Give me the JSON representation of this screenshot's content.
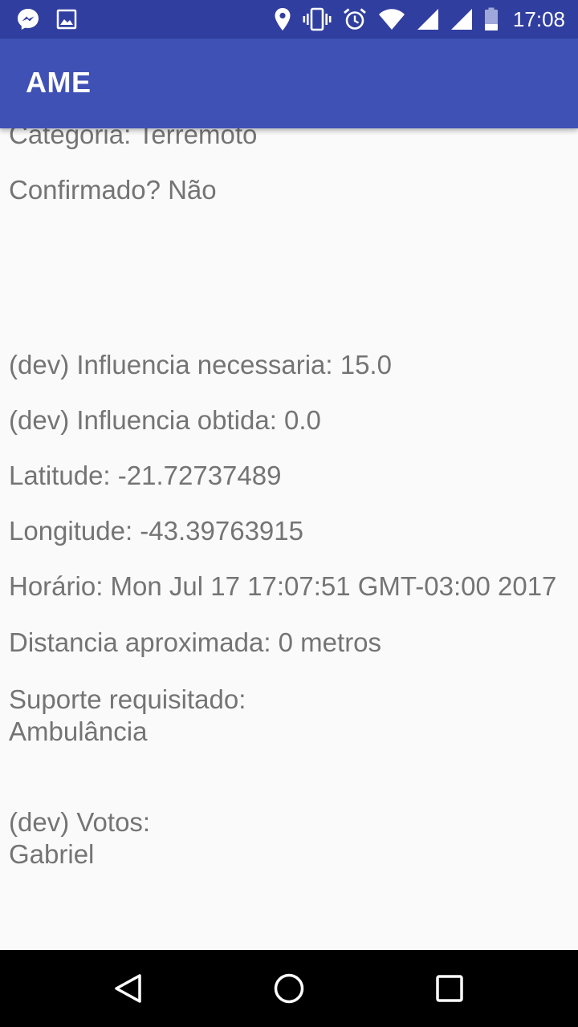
{
  "status_bar": {
    "time": "17:08",
    "icons_left": [
      "messenger-icon",
      "image-icon"
    ],
    "icons_right": [
      "location-icon",
      "vibrate-icon",
      "alarm-icon",
      "wifi-icon",
      "signal-icon",
      "signal-icon",
      "battery-icon"
    ],
    "color": "#303f9f"
  },
  "app_bar": {
    "title": "AME",
    "color": "#3f51b5"
  },
  "details": {
    "categoria": "Categoria: Terremoto",
    "confirmado": "Confirmado? Não",
    "influencia_necessaria": "(dev) Influencia necessaria: 15.0",
    "influencia_obtida": "(dev) Influencia obtida: 0.0",
    "latitude": "Latitude: -21.72737489",
    "longitude": "Longitude: -43.39763915",
    "horario": "Horário: Mon Jul 17 17:07:51 GMT-03:00 2017",
    "distancia": "Distancia aproximada: 0 metros",
    "suporte_label": "Suporte requisitado:",
    "suporte_value": "Ambulância",
    "votos_label": "(dev) Votos:",
    "votos_value": "Gabriel"
  },
  "nav_bar": {
    "icons": [
      "back-icon",
      "home-icon",
      "recents-icon"
    ]
  }
}
